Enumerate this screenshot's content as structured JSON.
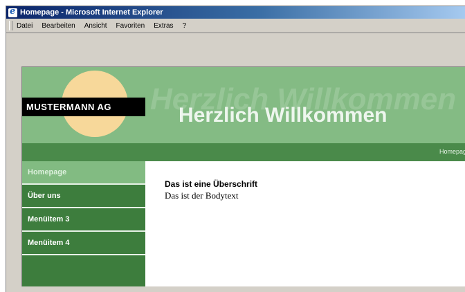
{
  "window": {
    "title": "Homepage - Microsoft Internet Explorer"
  },
  "menubar": {
    "items": [
      "Datei",
      "Bearbeiten",
      "Ansicht",
      "Favoriten",
      "Extras",
      "?"
    ]
  },
  "site": {
    "logo": "MUSTERMANN AG",
    "ghost_text": "Herzlich Willkommen",
    "headline": "Herzlich Willkommen",
    "breadcrumb": "Homepage",
    "nav": [
      "Homepage",
      "Über uns",
      "Menüitem 3",
      "Menüitem 4"
    ],
    "active_nav": "Homepage",
    "content": {
      "heading": "Das ist eine Überschrift",
      "body": "Das ist der Bodytext"
    }
  },
  "colors": {
    "header_green": "#84bb84",
    "nav_green": "#4a8a4a",
    "sidebar_green": "#3d7d3d",
    "sun": "#f7d89a"
  }
}
